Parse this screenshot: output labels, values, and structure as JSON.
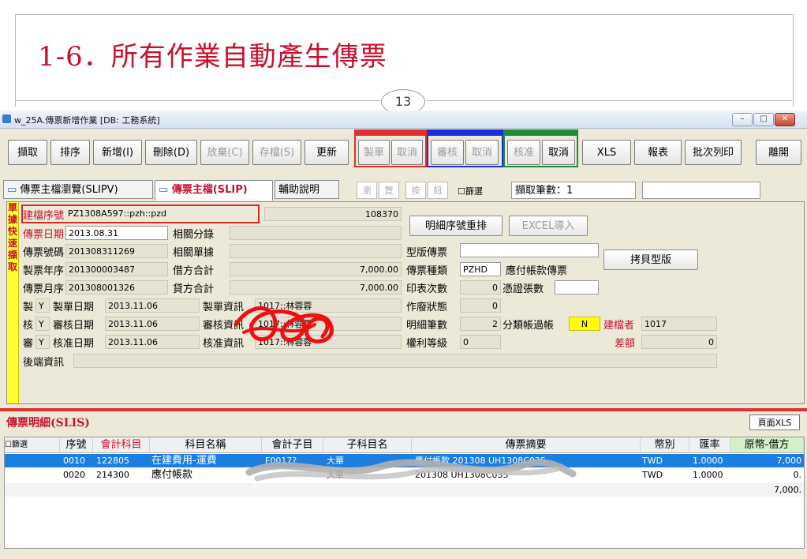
{
  "slide": {
    "title": "1-6．所有作業自動產生傳票",
    "page_number": "13"
  },
  "window": {
    "title": "w_25A.傳票新增作業 [DB: 工務系統]",
    "min": "–",
    "max": "□",
    "close": "✕"
  },
  "toolbar": {
    "buttons": [
      "擷取",
      "排序",
      "新增(I)",
      "刪除(D)",
      "放棄(C)",
      "存檔(S)",
      "更新"
    ],
    "make": [
      "製單",
      "取消"
    ],
    "audit": [
      "審核",
      "取消"
    ],
    "approve": [
      "核准",
      "取消"
    ],
    "xls": "XLS",
    "report": "報表",
    "batch_print": "批次列印",
    "exit": "離開"
  },
  "tabs": {
    "browse": "傳票主檔瀏覽(SLIPV)",
    "master": "傳票主檔(SLIP)",
    "help": "輔助說明",
    "small_btns": [
      "瀏",
      "覽",
      "按",
      "鈕"
    ],
    "filter": "篩選",
    "count_label": "擷取筆數：1"
  },
  "side_strip": [
    "單",
    "據",
    "快",
    "速",
    "擷",
    "取"
  ],
  "form": {
    "doc_no_label": "建檔序號",
    "doc_no": "PZ1308A597::pzh::pzd",
    "doc_no_num": "108370",
    "date_label": "傳票日期",
    "date": "2013.08.31",
    "category_label": "相關分錄",
    "slip_no_label": "傳票號碼",
    "slip_no": "201308311269",
    "related_label": "相關單據",
    "year_seq_label": "製票年序",
    "year_seq": "201300003487",
    "debit_label": "借方合計",
    "debit": "7,000.00",
    "month_seq_label": "傳票月序",
    "month_seq": "201308001326",
    "credit_label": "貸方合計",
    "credit": "7,000.00",
    "make_flag_label": "製",
    "make_flag": "Y",
    "make_date_label": "製單日期",
    "make_date": "2013.11.06",
    "make_info_label": "製單資訊",
    "make_info": "1017::林蓉蓉",
    "audit_flag_label": "核",
    "audit_flag": "Y",
    "audit_date_label": "審核日期",
    "audit_date": "2013.11.06",
    "audit_info_label": "審核資訊",
    "audit_info": "1017::林蓉蓉",
    "approve_flag_label": "審",
    "approve_flag": "Y",
    "approve_date_label": "核准日期",
    "approve_date": "2013.11.06",
    "approve_info_label": "核准資訊",
    "approve_info": "1017::林蓉蓉",
    "backend_label": "後端資訊",
    "reorder_btn": "明細序號重排",
    "excel_btn": "EXCEL導入",
    "template_label": "型版傳票",
    "copy_template_btn": "拷貝型版",
    "slip_type_label": "傳票種類",
    "slip_type": "PZHD",
    "slip_type_name": "應付帳款傳票",
    "print_count_label": "印表次數",
    "print_count": "0",
    "voucher_count_label": "憑證張數",
    "void_label": "作廢狀態",
    "void": "0",
    "detail_count_label": "明細筆數",
    "detail_count": "2",
    "class_post_label": "分類帳過帳",
    "class_post": "N",
    "creator_label": "建檔者",
    "creator": "1017",
    "rights_label": "權利等級",
    "rights": "0",
    "diff_label": "差額",
    "diff": "0"
  },
  "detail": {
    "title": "傳票明細(SLIS)",
    "page_xls": "頁面XLS",
    "headers": [
      "篩選",
      "序號",
      "會計科目",
      "科目名稱",
      "會計子目",
      "子科目名",
      "傳票摘要",
      "幣別",
      "匯率",
      "原幣-借方"
    ],
    "rows": [
      {
        "seq": "0010",
        "account": "122805",
        "name": "在建費用-運費",
        "sub": "F0017?",
        "subname": "大華",
        "memo": "應付帳款 201308 UH1308C035",
        "currency": "TWD",
        "rate": "1.0000",
        "debit": "7,000"
      },
      {
        "seq": "0020",
        "account": "214300",
        "name": "應付帳款",
        "sub": "",
        "subname": "大華",
        "memo": "201308 UH1308C035",
        "currency": "TWD",
        "rate": "1.0000",
        "debit": "0."
      }
    ],
    "total": "7,000."
  },
  "colors": {
    "accent_red": "#c8102e",
    "make_group": "#e03131",
    "audit_group": "#1a2fd6",
    "approve_group": "#1e8c3a",
    "selection": "#1c7ee0"
  }
}
